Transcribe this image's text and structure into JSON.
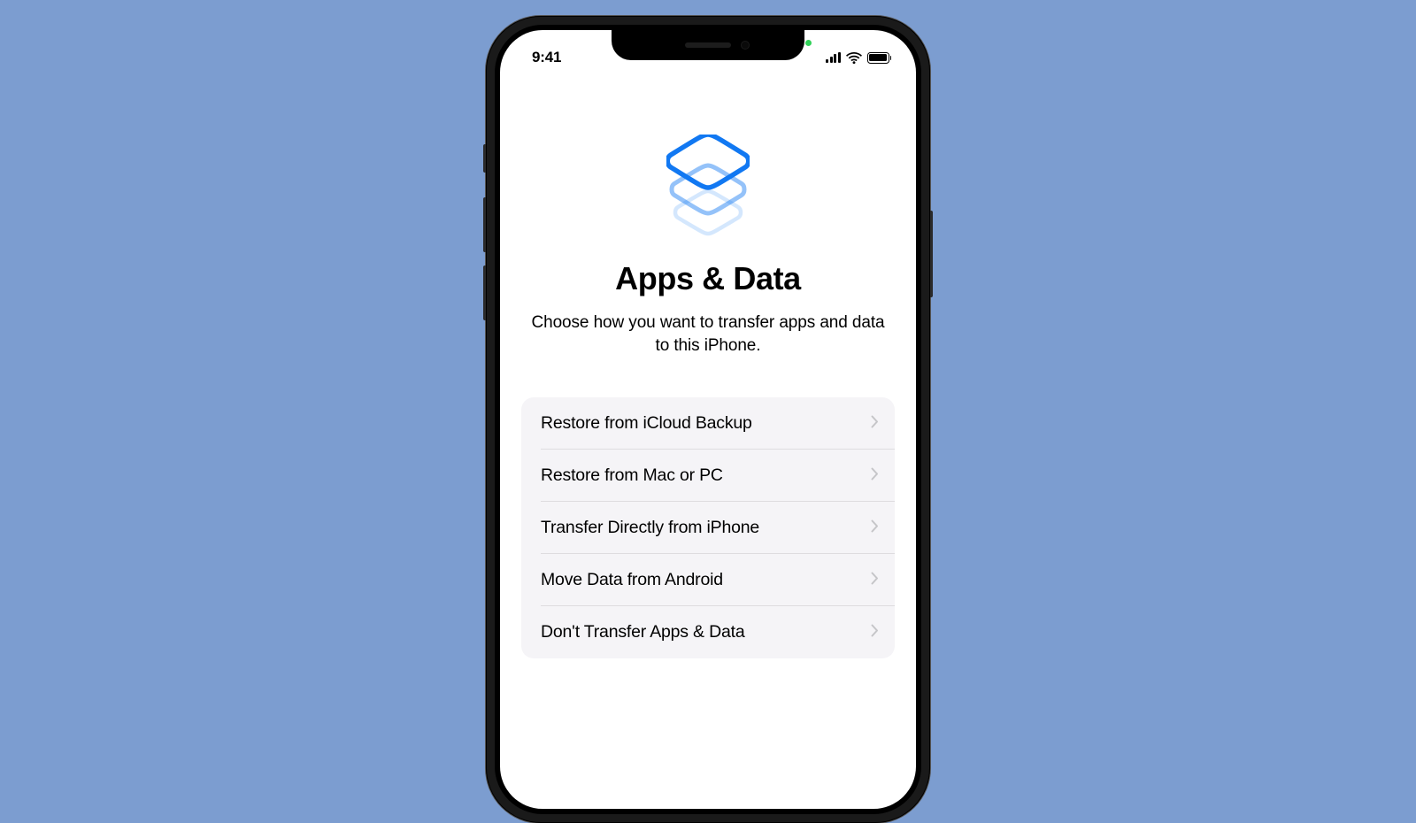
{
  "status_bar": {
    "time": "9:41"
  },
  "header": {
    "title": "Apps & Data",
    "subtitle": "Choose how you want to transfer apps and data to this iPhone."
  },
  "options": [
    {
      "label": "Restore from iCloud Backup"
    },
    {
      "label": "Restore from Mac or PC"
    },
    {
      "label": "Transfer Directly from iPhone"
    },
    {
      "label": "Move Data from Android"
    },
    {
      "label": "Don't Transfer Apps & Data"
    }
  ]
}
